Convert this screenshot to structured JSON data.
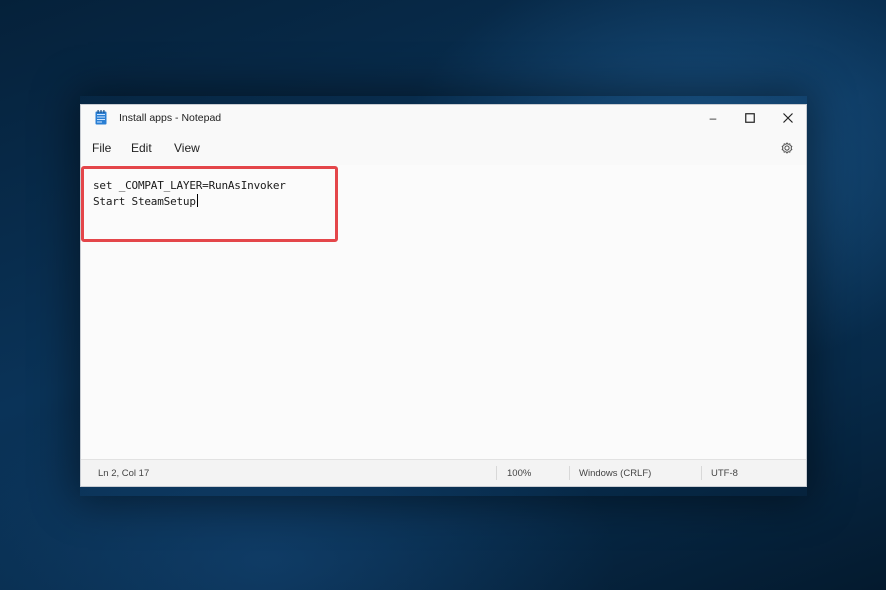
{
  "window": {
    "title": "Install apps - Notepad",
    "controls": {
      "minimize": "–",
      "maximize": "☐",
      "close": "✕"
    }
  },
  "menu": {
    "items": [
      "File",
      "Edit",
      "View"
    ],
    "settings_icon": "gear-icon"
  },
  "editor": {
    "lines": [
      "set _COMPAT_LAYER=RunAsInvoker",
      "Start SteamSetup"
    ]
  },
  "status": {
    "position": "Ln 2, Col 17",
    "zoom": "100%",
    "line_ending": "Windows (CRLF)",
    "encoding": "UTF-8"
  },
  "colors": {
    "highlight": "#e4464a",
    "window_bg": "#f9f9f9",
    "desktop": "#0a3358"
  }
}
